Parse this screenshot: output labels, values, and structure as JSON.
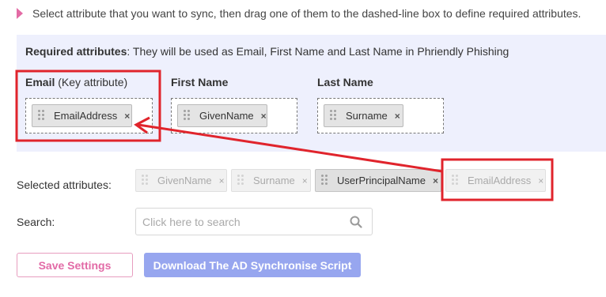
{
  "hint": {
    "text": "Select attribute that you want to sync, then drag one of them to the dashed-line box to define required attributes."
  },
  "required": {
    "title": "Required attributes",
    "description": ": They will be used as Email, First Name and Last Name in Phriendly Phishing",
    "columns": [
      {
        "label": "Email",
        "note": " (Key attribute)",
        "chip": "EmailAddress"
      },
      {
        "label": "First Name",
        "chip": "GivenName"
      },
      {
        "label": "Last Name",
        "chip": "Surname"
      }
    ]
  },
  "selected": {
    "label": "Selected attributes:",
    "chips": [
      {
        "text": "GivenName",
        "state": "disabled"
      },
      {
        "text": "Surname",
        "state": "disabled"
      },
      {
        "text": "UserPrincipalName",
        "state": "active"
      },
      {
        "text": "EmailAddress",
        "state": "disabled"
      }
    ]
  },
  "search": {
    "label": "Search:",
    "placeholder": "Click here to search"
  },
  "buttons": {
    "save": "Save Settings",
    "download": "Download The AD Synchronise Script"
  },
  "colors": {
    "accent_pink": "#e36ba5",
    "panel_bg": "#eef0fd",
    "primary_button": "#97a6ef",
    "annotation_red": "#e0242c"
  },
  "icons": {
    "search": "magnifier-icon",
    "remove": "close-icon",
    "drag": "drag-handle-icon",
    "bullet": "triangle-right-icon"
  }
}
